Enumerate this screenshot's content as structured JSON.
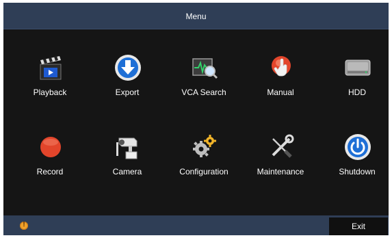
{
  "window": {
    "title": "Menu"
  },
  "menu": {
    "items": [
      {
        "label": "Playback",
        "icon": "clapperboard-play-icon"
      },
      {
        "label": "Export",
        "icon": "download-circle-icon"
      },
      {
        "label": "VCA Search",
        "icon": "waveform-search-icon"
      },
      {
        "label": "Manual",
        "icon": "hand-press-button-icon"
      },
      {
        "label": "HDD",
        "icon": "hard-disk-icon"
      },
      {
        "label": "Record",
        "icon": "record-dot-icon"
      },
      {
        "label": "Camera",
        "icon": "security-camera-icon"
      },
      {
        "label": "Configuration",
        "icon": "gears-icon"
      },
      {
        "label": "Maintenance",
        "icon": "wrench-screwdriver-icon"
      },
      {
        "label": "Shutdown",
        "icon": "power-icon"
      }
    ]
  },
  "footer": {
    "exit_label": "Exit",
    "status_icon": "warning-icon",
    "status_glyph": "!"
  },
  "colors": {
    "bar": "#2f3e56",
    "background": "#151515",
    "accent_blue": "#1e6fd6",
    "record_red": "#e2452b",
    "warning_orange": "#f0a12a"
  }
}
